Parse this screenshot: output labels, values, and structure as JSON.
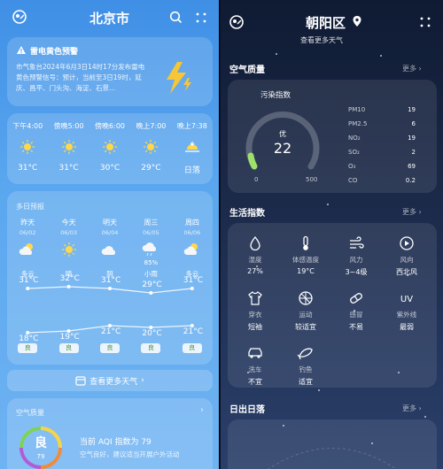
{
  "left": {
    "city": "北京市",
    "alert": {
      "title": "雷电黄色预警",
      "text": "市气象台2024年6月3日14时17分发布雷电黄色预警信号：预计，当前至3日19时，延庆、昌平、门头沟、海淀、石景..."
    },
    "hourly": [
      {
        "time": "下午4:00",
        "icon": "sun-icon",
        "value": "31°C"
      },
      {
        "time": "傍晚5:00",
        "icon": "sun-icon",
        "value": "31°C"
      },
      {
        "time": "傍晚6:00",
        "icon": "sun-icon",
        "value": "30°C"
      },
      {
        "time": "晚上7:00",
        "icon": "sun-icon",
        "value": "29°C"
      },
      {
        "time": "晚上7:38",
        "icon": "sunset-icon",
        "value": "日落"
      }
    ],
    "forecast_title": "多日预报",
    "days": [
      {
        "name": "昨天",
        "date": "06/02",
        "icon": "partly-cloudy-icon",
        "precip": "",
        "weather": "多云",
        "high": "31°C",
        "low": "18°C",
        "aqi": "良"
      },
      {
        "name": "今天",
        "date": "06/03",
        "icon": "sun-icon",
        "precip": "",
        "weather": "晴",
        "high": "32°C",
        "low": "19°C",
        "aqi": "良"
      },
      {
        "name": "明天",
        "date": "06/04",
        "icon": "cloudy-icon",
        "precip": "",
        "weather": "阴",
        "high": "31°C",
        "low": "21°C",
        "aqi": "良"
      },
      {
        "name": "周三",
        "date": "06/05",
        "icon": "rain-icon",
        "precip": "85%",
        "weather": "小雨",
        "high": "29°C",
        "low": "20°C",
        "aqi": "良"
      },
      {
        "name": "周四",
        "date": "06/06",
        "icon": "partly-cloudy-icon",
        "precip": "",
        "weather": "多云",
        "high": "31°C",
        "low": "21°C",
        "aqi": "良"
      }
    ],
    "more_weather": "查看更多天气",
    "aq_title": "空气质量",
    "aq_badge": "良",
    "aq_badge_num": "79",
    "aq_headline": "当前 AQI 指数为 79",
    "aq_desc": "空气良好，建议适当开展户外活动"
  },
  "right": {
    "city": "朝阳区",
    "top_link": "查看更多天气",
    "aq_title": "空气质量",
    "more": "更多",
    "pollution_title": "污染指数",
    "pollution_level": "优",
    "pollution_value": "22",
    "gauge_min": "0",
    "gauge_max": "500",
    "pollutants": [
      {
        "name": "PM10",
        "value": "19"
      },
      {
        "name": "PM2.5",
        "value": "6"
      },
      {
        "name": "NO₂",
        "value": "19"
      },
      {
        "name": "SO₂",
        "value": "2"
      },
      {
        "name": "O₃",
        "value": "69"
      },
      {
        "name": "CO",
        "value": "0.2"
      }
    ],
    "life_title": "生活指数",
    "life": [
      {
        "name": "湿度",
        "value": "27%",
        "icon": "droplet-icon"
      },
      {
        "name": "体感温度",
        "value": "19°C",
        "icon": "thermometer-icon"
      },
      {
        "name": "风力",
        "value": "3~4级",
        "icon": "wind-icon"
      },
      {
        "name": "风向",
        "value": "西北风",
        "icon": "compass-icon"
      },
      {
        "name": "穿衣",
        "value": "短袖",
        "icon": "shirt-icon"
      },
      {
        "name": "运动",
        "value": "较适宜",
        "icon": "ball-icon"
      },
      {
        "name": "感冒",
        "value": "不易",
        "icon": "pill-icon"
      },
      {
        "name": "紫外线",
        "value": "最弱",
        "icon": "uv-icon"
      },
      {
        "name": "洗车",
        "value": "不宜",
        "icon": "car-icon"
      },
      {
        "name": "钓鱼",
        "value": "适宜",
        "icon": "fish-icon"
      }
    ],
    "sun_title": "日出日落"
  }
}
